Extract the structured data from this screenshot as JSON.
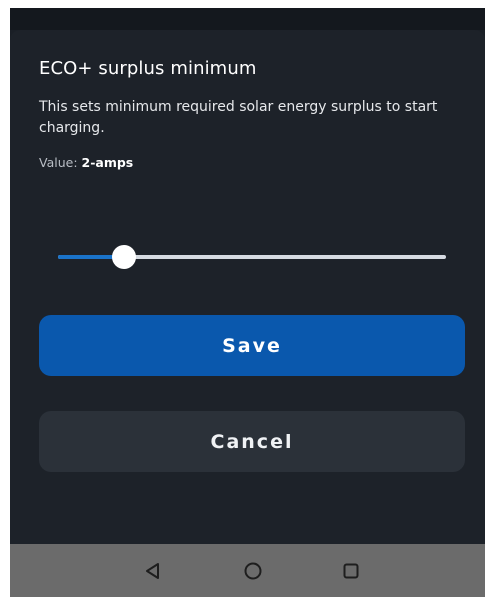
{
  "dialog": {
    "title": "ECO+ surplus minimum",
    "description": "This sets minimum required solar energy surplus to start charging.",
    "value_label": "Value: ",
    "value": "2-amps"
  },
  "slider": {
    "level_fraction": 0.17
  },
  "buttons": {
    "save_label": "Save",
    "cancel_label": "Cancel"
  },
  "navbar": {
    "icons": [
      "back-icon",
      "home-icon",
      "recents-icon"
    ]
  },
  "colors": {
    "accent": "#0a58ad",
    "dialog_bg": "#1d2229",
    "cancel_bg": "#2b3139",
    "navbar_bg": "#6b6b6b"
  }
}
